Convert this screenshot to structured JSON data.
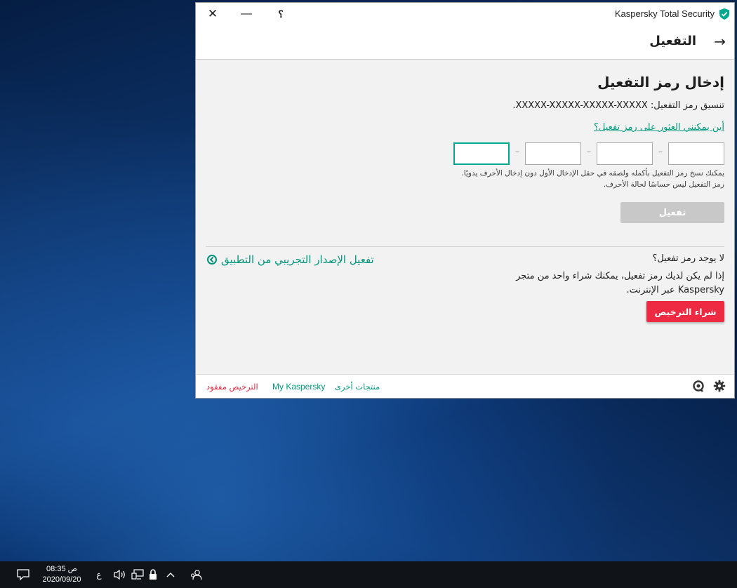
{
  "window": {
    "app_title": "Kaspersky Total Security",
    "help_label": "؟",
    "minimize_label": "—",
    "close_label": "✕"
  },
  "header": {
    "back_label": "←",
    "title": "التفعيل"
  },
  "activation": {
    "section_title": "إدخال رمز التفعيل",
    "format_text": "تنسيق رمز التفعيل: XXXXX-XXXXX-XXXXX-XXXXX.",
    "help_link": "أين يمكنني العثور على رمز تفعيل؟",
    "fields": [
      "",
      "",
      "",
      ""
    ],
    "separator": "–",
    "hint_line1": "يمكنك نسخ رمز التفعيل بأكمله ولصقه في حقل الإدخال الأول دون إدخال الأحرف يدويًا.",
    "hint_line2": "رمز التفعيل ليس حساسًا لحالة الأحرف.",
    "activate_button": "تفعيل"
  },
  "no_code": {
    "title": "لا يوجد رمز تفعيل؟",
    "line1": "إذا لم يكن لديك رمز تفعيل، يمكنك شراء واحد من متجر",
    "line2": "Kaspersky عبر الإنترنت.",
    "buy_button": "شراء الترخيص",
    "trial_link": "تفعيل الإصدار التجريبي من التطبيق"
  },
  "footer": {
    "other_products": "منتجات أخرى",
    "my_kaspersky": "My Kaspersky",
    "license_lost": "الترخيص مفقود"
  },
  "taskbar": {
    "time": "08:35 ص",
    "date": "2020/09/20",
    "language": "ع",
    "up_arrow": "^"
  },
  "colors": {
    "accent": "#009b7d",
    "buy": "#ee2a43",
    "disabled_button": "#c8c8c8"
  }
}
